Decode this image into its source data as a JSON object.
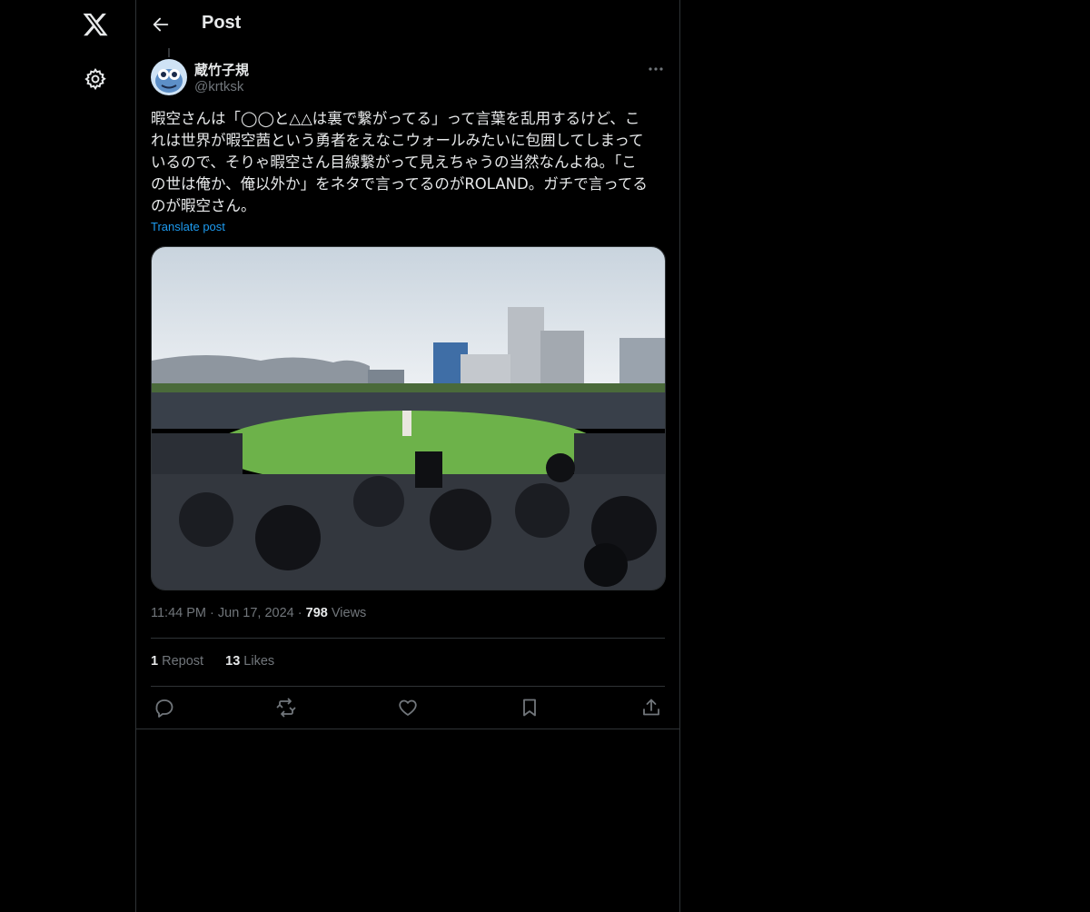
{
  "header": {
    "title": "Post"
  },
  "post": {
    "display_name": "蔵竹子規",
    "handle": "@krtksk",
    "text": "暇空さんは「◯◯と△△は裏で繋がってる」って言葉を乱用するけど、こ\nれは世界が暇空茜という勇者をえなこウォールみたいに包囲してしまって\nいるので、そりゃ暇空さん目線繋がって見えちゃうの当然なんよね。「こ\nの世は俺か、俺以外か」をネタで言ってるのがROLAND。ガチで言ってる\nのが暇空さん。",
    "translate_label": "Translate post",
    "time": "11:44 PM",
    "date": "Jun 17, 2024",
    "views_count": "798",
    "views_label": "Views",
    "reposts_count": "1",
    "reposts_label": "Repost",
    "likes_count": "13",
    "likes_label": "Likes"
  },
  "icons": {
    "logo": "x-logo-icon",
    "settings": "gear-icon",
    "back": "arrow-left-icon",
    "more": "more-dots-icon",
    "reply": "reply-icon",
    "repost": "repost-icon",
    "like": "heart-icon",
    "bookmark": "bookmark-icon",
    "share": "share-icon"
  },
  "colors": {
    "background": "#000000",
    "text": "#e7e9ea",
    "secondary": "#71767b",
    "link": "#1d9bf0",
    "border": "#2f3336"
  }
}
